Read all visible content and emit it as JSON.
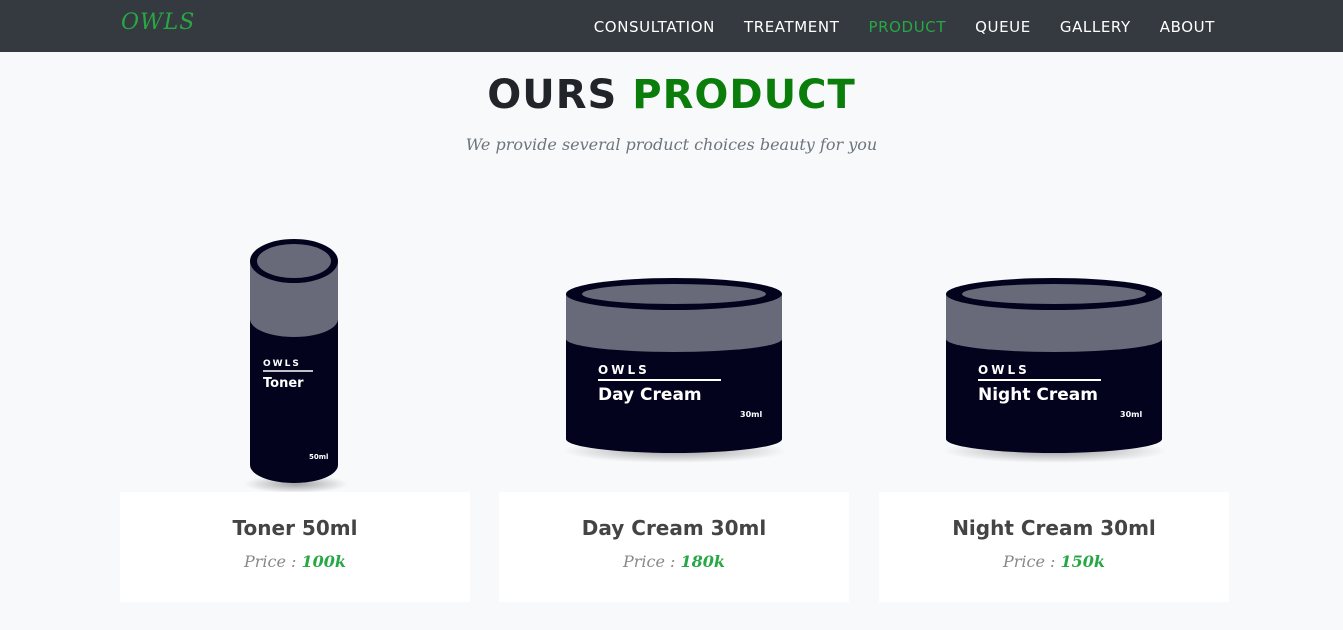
{
  "nav": {
    "brand": "OWLS",
    "items": [
      {
        "label": "CONSULTATION",
        "active": false
      },
      {
        "label": "TREATMENT",
        "active": false
      },
      {
        "label": "PRODUCT",
        "active": true
      },
      {
        "label": "QUEUE",
        "active": false
      },
      {
        "label": "GALLERY",
        "active": false
      },
      {
        "label": "ABOUT",
        "active": false
      }
    ]
  },
  "section": {
    "title_part1": "OURS",
    "title_part2": "PRODUCT",
    "subtitle": "We provide several product choices beauty for you"
  },
  "products": [
    {
      "name": "Toner 50ml",
      "price_label": "Price :",
      "price": "100k",
      "package_brand": "OWLS",
      "package_name": "Toner",
      "package_size": "50ml"
    },
    {
      "name": "Day Cream 30ml",
      "price_label": "Price :",
      "price": "180k",
      "package_brand": "OWLS",
      "package_name": "Day Cream",
      "package_size": "30ml"
    },
    {
      "name": "Night Cream 30ml",
      "price_label": "Price :",
      "price": "150k",
      "package_brand": "OWLS",
      "package_name": "Night Cream",
      "package_size": "30ml"
    }
  ],
  "colors": {
    "navbar": "#343a40",
    "accent_green": "#28a745",
    "title_green": "#0a7d0a",
    "package_body": "#03031e",
    "package_lid": "#686a7a"
  }
}
